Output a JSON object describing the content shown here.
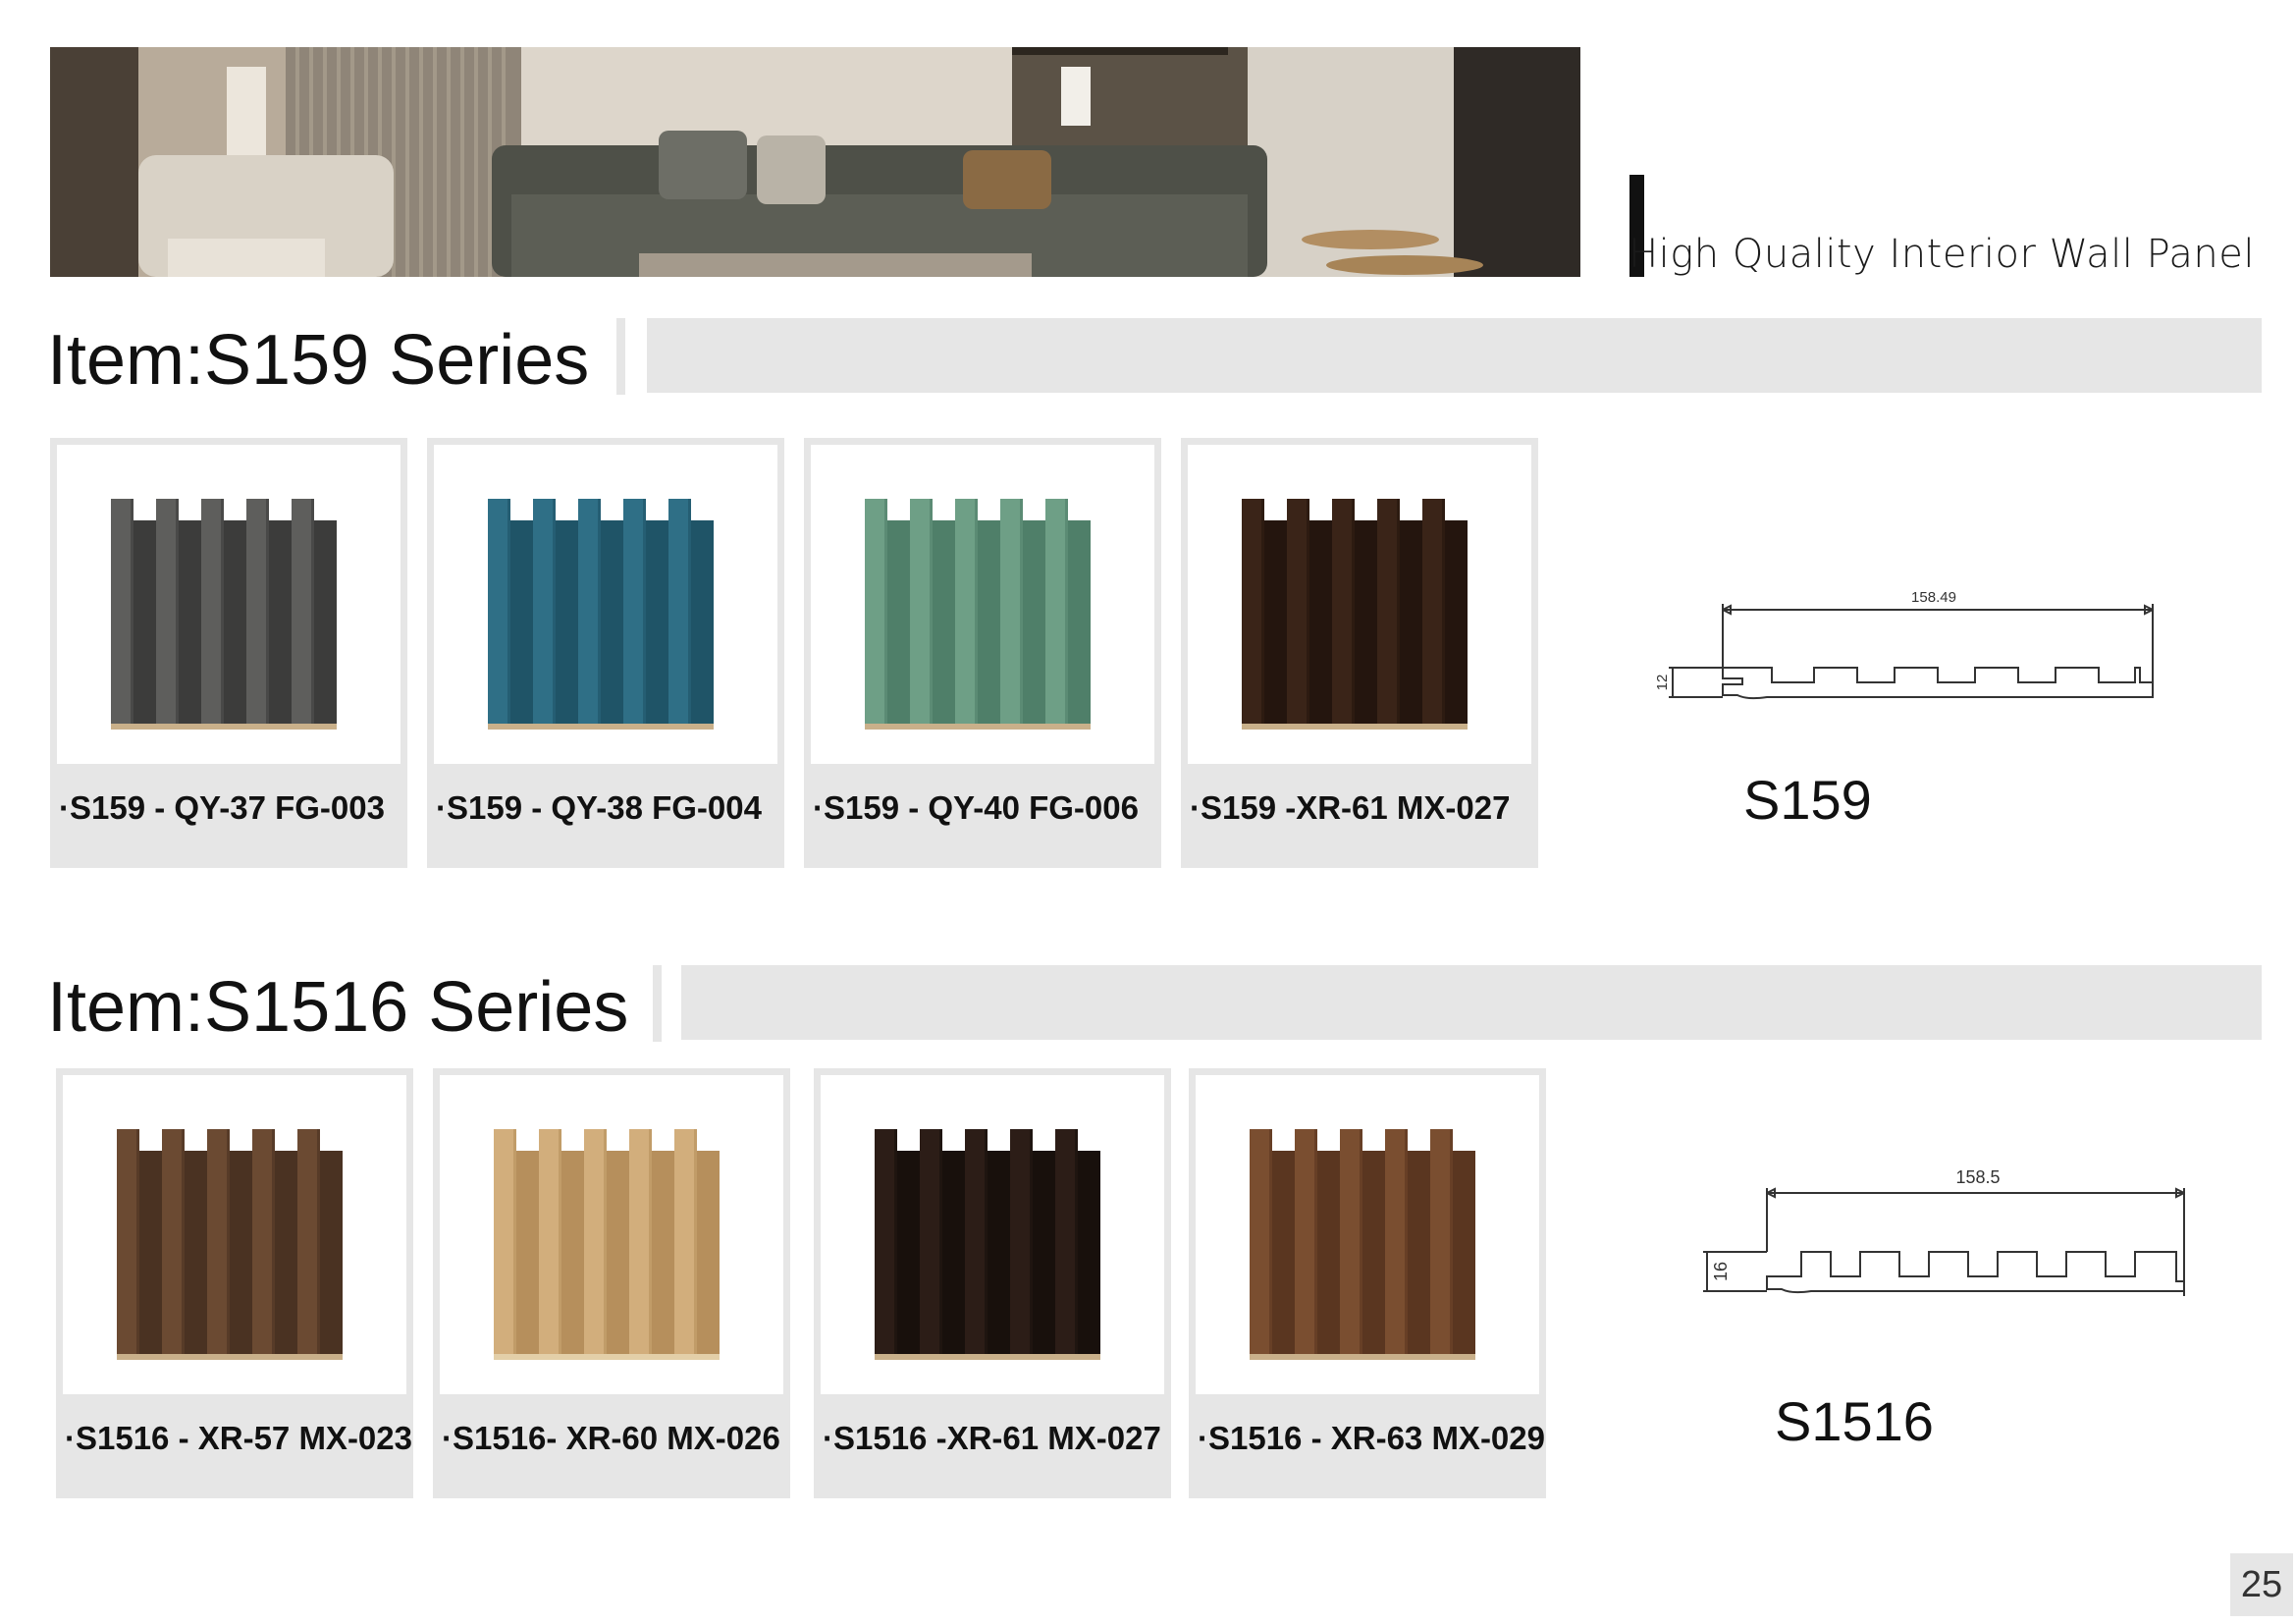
{
  "header": {
    "tagline": "High Quality Interior Wall Panel"
  },
  "series": [
    {
      "title": "Item:S159 Series",
      "profile": {
        "name": "S159",
        "width_label": "158.49",
        "height_label": "12"
      },
      "items": [
        {
          "label": "·S159 - QY-37 FG-003",
          "colors": {
            "face": "#5e5e5c",
            "groove": "#3c3c3b",
            "base": "#c9b08a"
          }
        },
        {
          "label": "·S159 - QY-38 FG-004",
          "colors": {
            "face": "#2f6f86",
            "groove": "#1f5467",
            "base": "#c9b08a"
          }
        },
        {
          "label": "·S159 - QY-40 FG-006",
          "colors": {
            "face": "#6e9f86",
            "groove": "#4f7f69",
            "base": "#c9b08a"
          }
        },
        {
          "label": "·S159 -XR-61 MX-027",
          "colors": {
            "face": "#3a2418",
            "groove": "#24150e",
            "base": "#c9b08a"
          }
        }
      ]
    },
    {
      "title": "Item:S1516 Series",
      "profile": {
        "name": "S1516",
        "width_label": "158.5",
        "height_label": "16"
      },
      "items": [
        {
          "label": "·S1516 - XR-57 MX-023",
          "colors": {
            "face": "#6b4a32",
            "groove": "#4a3222",
            "base": "#c9b08a"
          }
        },
        {
          "label": "·S1516- XR-60 MX-026",
          "colors": {
            "face": "#d2ae7c",
            "groove": "#b68f5c",
            "base": "#e3cfa8"
          }
        },
        {
          "label": "·S1516 -XR-61 MX-027",
          "colors": {
            "face": "#2c1d17",
            "groove": "#18100c",
            "base": "#c9b08a"
          }
        },
        {
          "label": "·S1516 -  XR-63 MX-029",
          "colors": {
            "face": "#7a4e30",
            "groove": "#5a3620",
            "base": "#c9b08a"
          }
        }
      ]
    }
  ],
  "footer": {
    "page_number": "25"
  }
}
